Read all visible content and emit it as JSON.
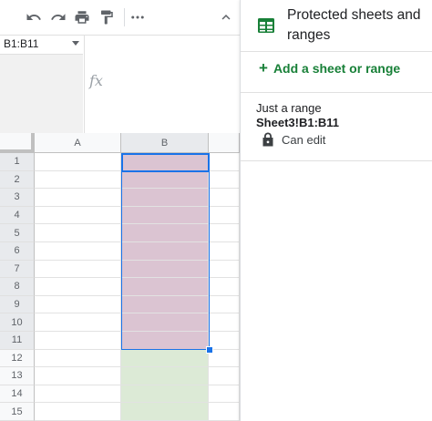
{
  "toolbar": {
    "buttons": [
      "undo-icon",
      "redo-icon",
      "print-icon",
      "paint-format-icon",
      "more-icon",
      "collapse-icon"
    ]
  },
  "namebox": {
    "value": "B1:B11"
  },
  "formula": {
    "fx_label": "fx"
  },
  "grid": {
    "columns": [
      "A",
      "B"
    ],
    "rows": [
      "1",
      "2",
      "3",
      "4",
      "5",
      "6",
      "7",
      "8",
      "9",
      "10",
      "11",
      "12",
      "13",
      "14",
      "15"
    ],
    "protected_range": "B1:B11"
  },
  "panel": {
    "title": "Protected sheets and ranges",
    "add_label": "Add a sheet or range",
    "items": [
      {
        "description": "Just a range",
        "range": "Sheet3!B1:B11",
        "permission": "Can edit"
      }
    ]
  },
  "colors": {
    "protected_fill": "#dbc4d2",
    "unprotected_fill": "#dcead6",
    "selection": "#1a73e8",
    "add_link": "#188038"
  }
}
